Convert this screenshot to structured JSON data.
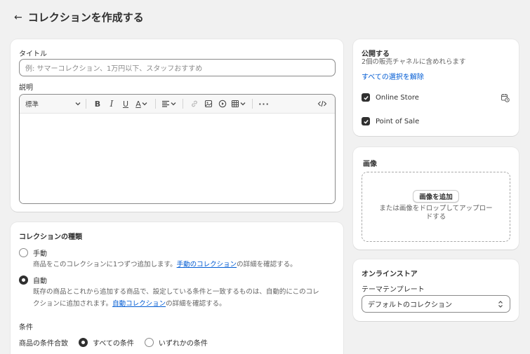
{
  "header": {
    "title": "コレクションを作成する"
  },
  "main": {
    "title_label": "タイトル",
    "title_placeholder": "例: サマーコレクション、1万円以下、スタッフおすすめ",
    "description_label": "説明",
    "editor": {
      "format_select": "標準"
    }
  },
  "collection_type": {
    "heading": "コレクションの種類",
    "manual": {
      "label": "手動",
      "desc_before": "商品をこのコレクションに1つずつ追加します。",
      "desc_link": "手動のコレクション",
      "desc_after": "の詳細を確認する。"
    },
    "automatic": {
      "label": "自動",
      "desc_line1": "既存の商品とこれから追加する商品で、設定している条件と一致するものは、自動的にこのコレ",
      "desc_line2_before": "クションに追加されます。",
      "desc_link": "自動コレクション",
      "desc_after": "の詳細を確認する。"
    },
    "conditions_heading": "条件",
    "match_label": "商品の条件合致",
    "match_all": "すべての条件",
    "match_any": "いずれかの条件"
  },
  "publish": {
    "heading": "公開する",
    "subtitle": "2個の販売チャネルに含めれらます",
    "deselect_all": "すべての選択を解除",
    "channels": [
      {
        "label": "Online Store"
      },
      {
        "label": "Point of Sale"
      }
    ]
  },
  "image": {
    "heading": "画像",
    "add_button": "画像を追加",
    "drop_text_line1": "または画像をドロップしてアップロー",
    "drop_text_line2": "ドする"
  },
  "online_store": {
    "heading": "オンラインストア",
    "template_label": "テーマテンプレート",
    "template_value": "デフォルトのコレクション"
  }
}
